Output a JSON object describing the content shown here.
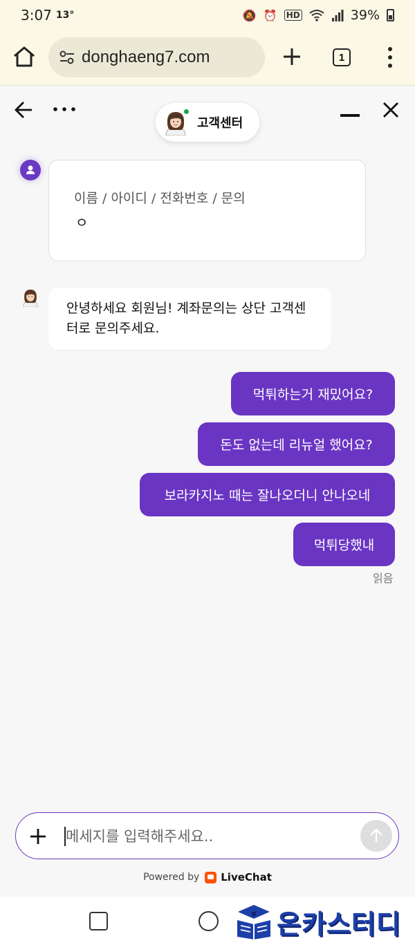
{
  "status_bar": {
    "time": "3:07",
    "temperature": "13°",
    "battery_percent": "39%"
  },
  "browser": {
    "url": "donghaeng7.com",
    "tab_count": "1"
  },
  "chat_header": {
    "title": "고객센터"
  },
  "prechat_form": {
    "label": "이름 / 아이디 / 전화번호 / 문의",
    "value": "ㅇ"
  },
  "messages": {
    "agent_1": "안녕하세요 회원님! 계좌문의는 상단 고객센터로 문의주세요.",
    "visitor_1": "먹튀하는거 재밌어요?",
    "visitor_2": "돈도 없는데 리뉴얼 했어요?",
    "visitor_3": "보라카지노 때는 잘나오더니 안나오네",
    "visitor_4": "먹튀당했내",
    "read_status": "읽음"
  },
  "composer": {
    "placeholder": "메세지를 입력해주세요.."
  },
  "footer": {
    "powered_by": "Powered by",
    "brand": "LiveChat"
  },
  "watermark": {
    "text": "온카스터디"
  },
  "colors": {
    "accent": "#6a35c3",
    "online": "#1ea54a",
    "livechat": "#ff5100"
  }
}
